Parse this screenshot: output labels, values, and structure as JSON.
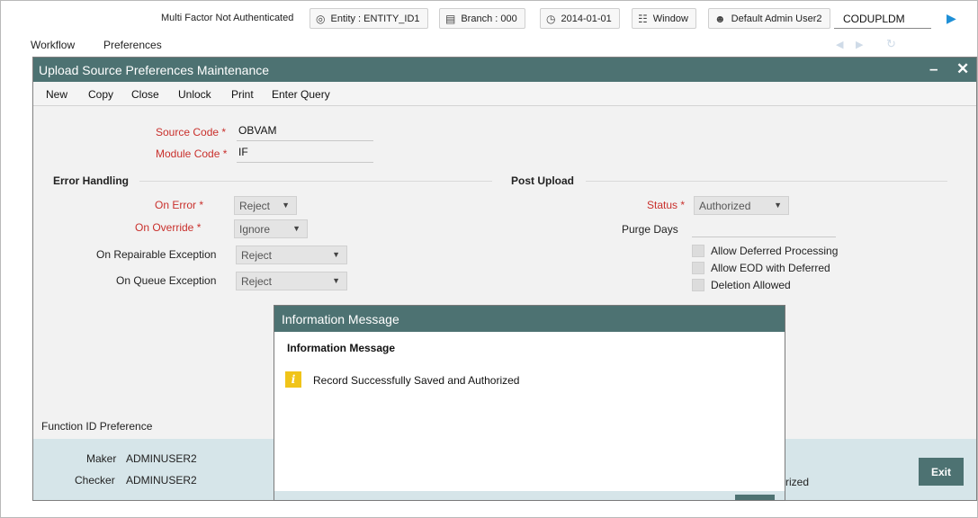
{
  "topbar": {
    "mfa_status": "Multi Factor Not Authenticated",
    "entity": "Entity : ENTITY_ID1",
    "branch": "Branch : 000",
    "date": "2014-01-01",
    "window": "Window",
    "user": "Default Admin User2",
    "function_id": "CODUPLDM"
  },
  "menubar": {
    "workflow": "Workflow",
    "preferences": "Preferences"
  },
  "window": {
    "title": "Upload Source Preferences Maintenance",
    "toolbar": [
      "New",
      "Copy",
      "Close",
      "Unlock",
      "Print",
      "Enter Query"
    ]
  },
  "form": {
    "source_code_label": "Source Code",
    "source_code": "OBVAM",
    "module_code_label": "Module Code",
    "module_code": "IF",
    "error_handling": {
      "title": "Error Handling",
      "on_error_label": "On Error",
      "on_error": "Reject",
      "on_override_label": "On Override",
      "on_override": "Ignore",
      "on_repairable_label": "On Repairable Exception",
      "on_repairable": "Reject",
      "on_queue_label": "On Queue Exception",
      "on_queue": "Reject"
    },
    "post_upload": {
      "title": "Post Upload",
      "status_label": "Status",
      "status": "Authorized",
      "purge_days_label": "Purge Days",
      "purge_days": "",
      "allow_deferred": "Allow Deferred Processing",
      "allow_eod_deferred": "Allow EOD with Deferred",
      "deletion_allowed": "Deletion Allowed"
    },
    "function_id_pref": "Function ID Preference"
  },
  "footer": {
    "maker_label": "Maker",
    "maker": "ADMINUSER2",
    "checker_label": "Checker",
    "checker": "ADMINUSER2",
    "auth_status_partial": "rized",
    "exit": "Exit"
  },
  "dialog": {
    "title": "Information Message",
    "heading": "Information Message",
    "icon_glyph": "i",
    "message": "Record Successfully Saved and Authorized"
  },
  "colors": {
    "title_bar": "#4d7272",
    "required": "#c9302c",
    "footer_bg": "#d6e5e9",
    "accent": "#1e8fd6",
    "info_icon": "#f0c419"
  }
}
